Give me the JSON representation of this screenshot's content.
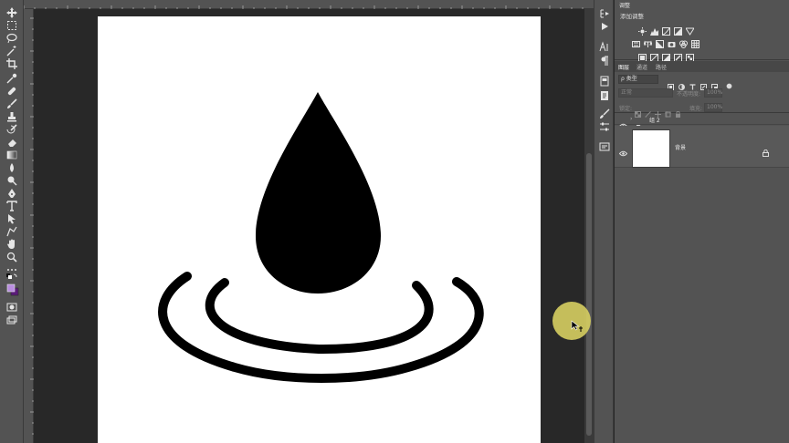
{
  "toolbar": {
    "tools": [
      "move-tool",
      "marquee-tool",
      "lasso-tool",
      "magic-wand-tool",
      "crop-tool",
      "eyedropper-tool",
      "healing-brush-tool",
      "brush-tool",
      "clone-stamp-tool",
      "history-brush-tool",
      "eraser-tool",
      "gradient-tool",
      "blur-tool",
      "dodge-tool",
      "pen-tool",
      "type-tool",
      "path-selection-tool",
      "shape-tool",
      "hand-tool",
      "zoom-tool",
      "more-tools",
      "default-colors",
      "foreground-background-colors",
      "quick-mask",
      "screen-mode"
    ],
    "foreground_color": "#b98de0",
    "background_color": "#5a1a7a"
  },
  "canvas": {
    "background_color": "#ffffff",
    "artwork": "water-drop-with-ripples",
    "artwork_color": "#000000"
  },
  "adjustments_panel": {
    "title": "调整",
    "add_label": "添加调整",
    "icons": [
      "brightness-icon",
      "levels-icon",
      "curves-icon",
      "exposure-icon",
      "vibrance-icon",
      "hue-icon",
      "color-balance-icon",
      "black-white-icon",
      "photo-filter-icon",
      "channel-mixer-icon",
      "color-lookup-icon",
      "invert-icon",
      "posterize-icon",
      "threshold-icon",
      "gradient-map-icon",
      "selective-color-icon"
    ]
  },
  "layers_panel": {
    "tabs": [
      {
        "label": "图层",
        "active": true
      },
      {
        "label": "通道",
        "active": false
      },
      {
        "label": "路径",
        "active": false
      }
    ],
    "filter_label": "ρ 类型",
    "blend_mode": "正常",
    "opacity_label": "不透明度:",
    "opacity_value": "100%",
    "lock_label": "锁定:",
    "fill_label": "填充:",
    "fill_value": "100%",
    "layers": [
      {
        "name": "组 2",
        "kind": "group",
        "visible": true
      },
      {
        "name": "背景",
        "kind": "background",
        "visible": true,
        "locked": true
      }
    ]
  }
}
